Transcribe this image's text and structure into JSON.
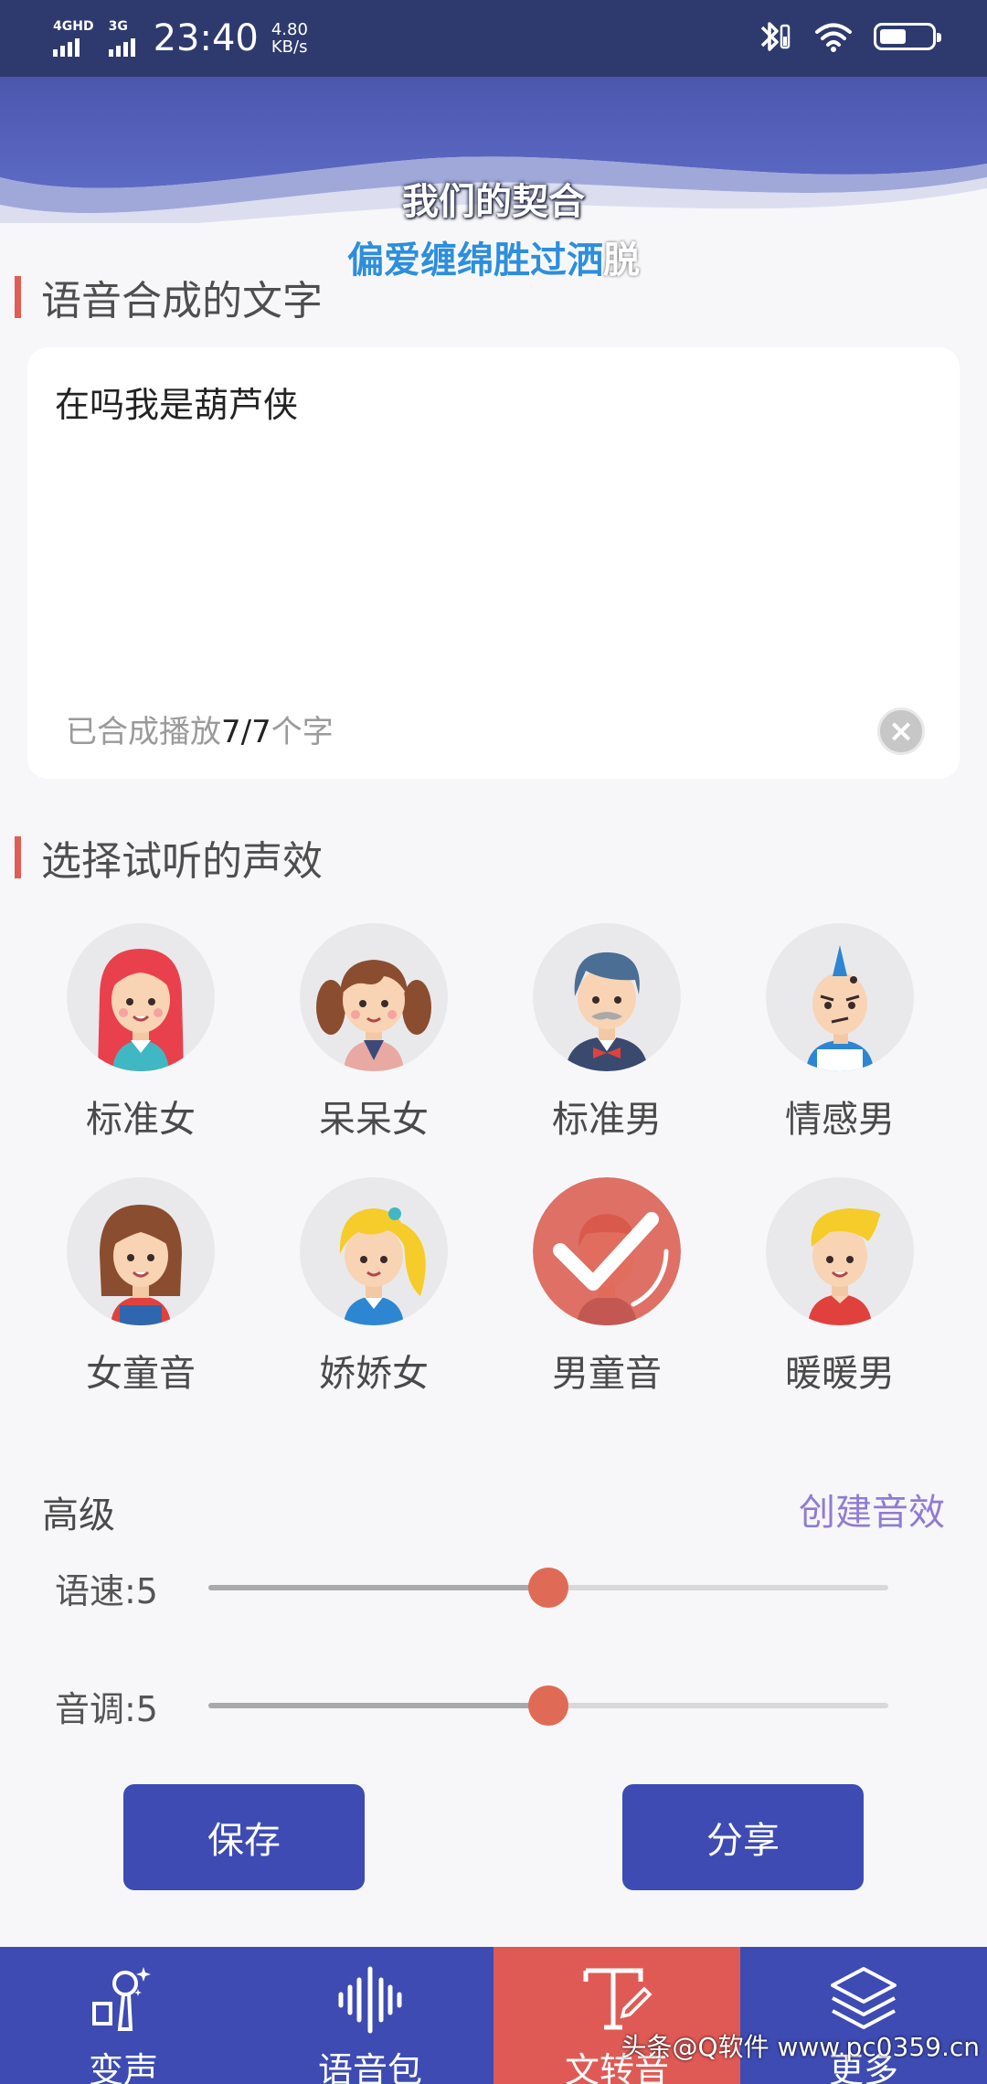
{
  "status_bar": {
    "network_1": "4GHD",
    "network_2": "3G",
    "time": "23:40",
    "speed_value": "4.80",
    "speed_unit": "KB/s"
  },
  "lyrics": {
    "line1": "我们的契合",
    "line2_sung": "偏爱缠绵胜过洒",
    "line2_rest": "脱"
  },
  "synthesis": {
    "section_title": "语音合成的文字",
    "text": "在吗我是葫芦侠",
    "counter_prefix": "已合成播放",
    "counter_value": "7/7",
    "counter_suffix": "个字"
  },
  "effects": {
    "section_title": "选择试听的声效",
    "items": [
      {
        "label": "标准女",
        "icon": "standard-female-avatar"
      },
      {
        "label": "呆呆女",
        "icon": "dull-girl-avatar"
      },
      {
        "label": "标准男",
        "icon": "standard-male-avatar"
      },
      {
        "label": "情感男",
        "icon": "emotional-male-avatar"
      },
      {
        "label": "女童音",
        "icon": "girl-child-avatar"
      },
      {
        "label": "娇娇女",
        "icon": "cute-girl-avatar"
      },
      {
        "label": "男童音",
        "icon": "boy-child-avatar",
        "selected": true
      },
      {
        "label": "暖暖男",
        "icon": "warm-male-avatar"
      }
    ]
  },
  "advanced": {
    "label": "高级",
    "create_link": "创建音效",
    "speed": {
      "label": "语速:5",
      "value": 5,
      "max": 10
    },
    "pitch": {
      "label": "音调:5",
      "value": 5,
      "max": 10
    }
  },
  "buttons": {
    "save": "保存",
    "share": "分享"
  },
  "nav": [
    {
      "label": "变声",
      "icon": "voice-change-icon"
    },
    {
      "label": "语音包",
      "icon": "soundwave-icon"
    },
    {
      "label": "文转音",
      "icon": "text-to-speech-icon",
      "active": true
    },
    {
      "label": "更多",
      "icon": "layers-icon"
    }
  ],
  "watermark": "头条@Q软件 www.pc0359.cn",
  "colors": {
    "status_bar": "#2e3a6e",
    "primary": "#3d4bb3",
    "accent_red": "#e05a55",
    "slider_thumb": "#df6b56",
    "create_link": "#8f7cd4",
    "lyric_highlight": "#2d8ede"
  }
}
